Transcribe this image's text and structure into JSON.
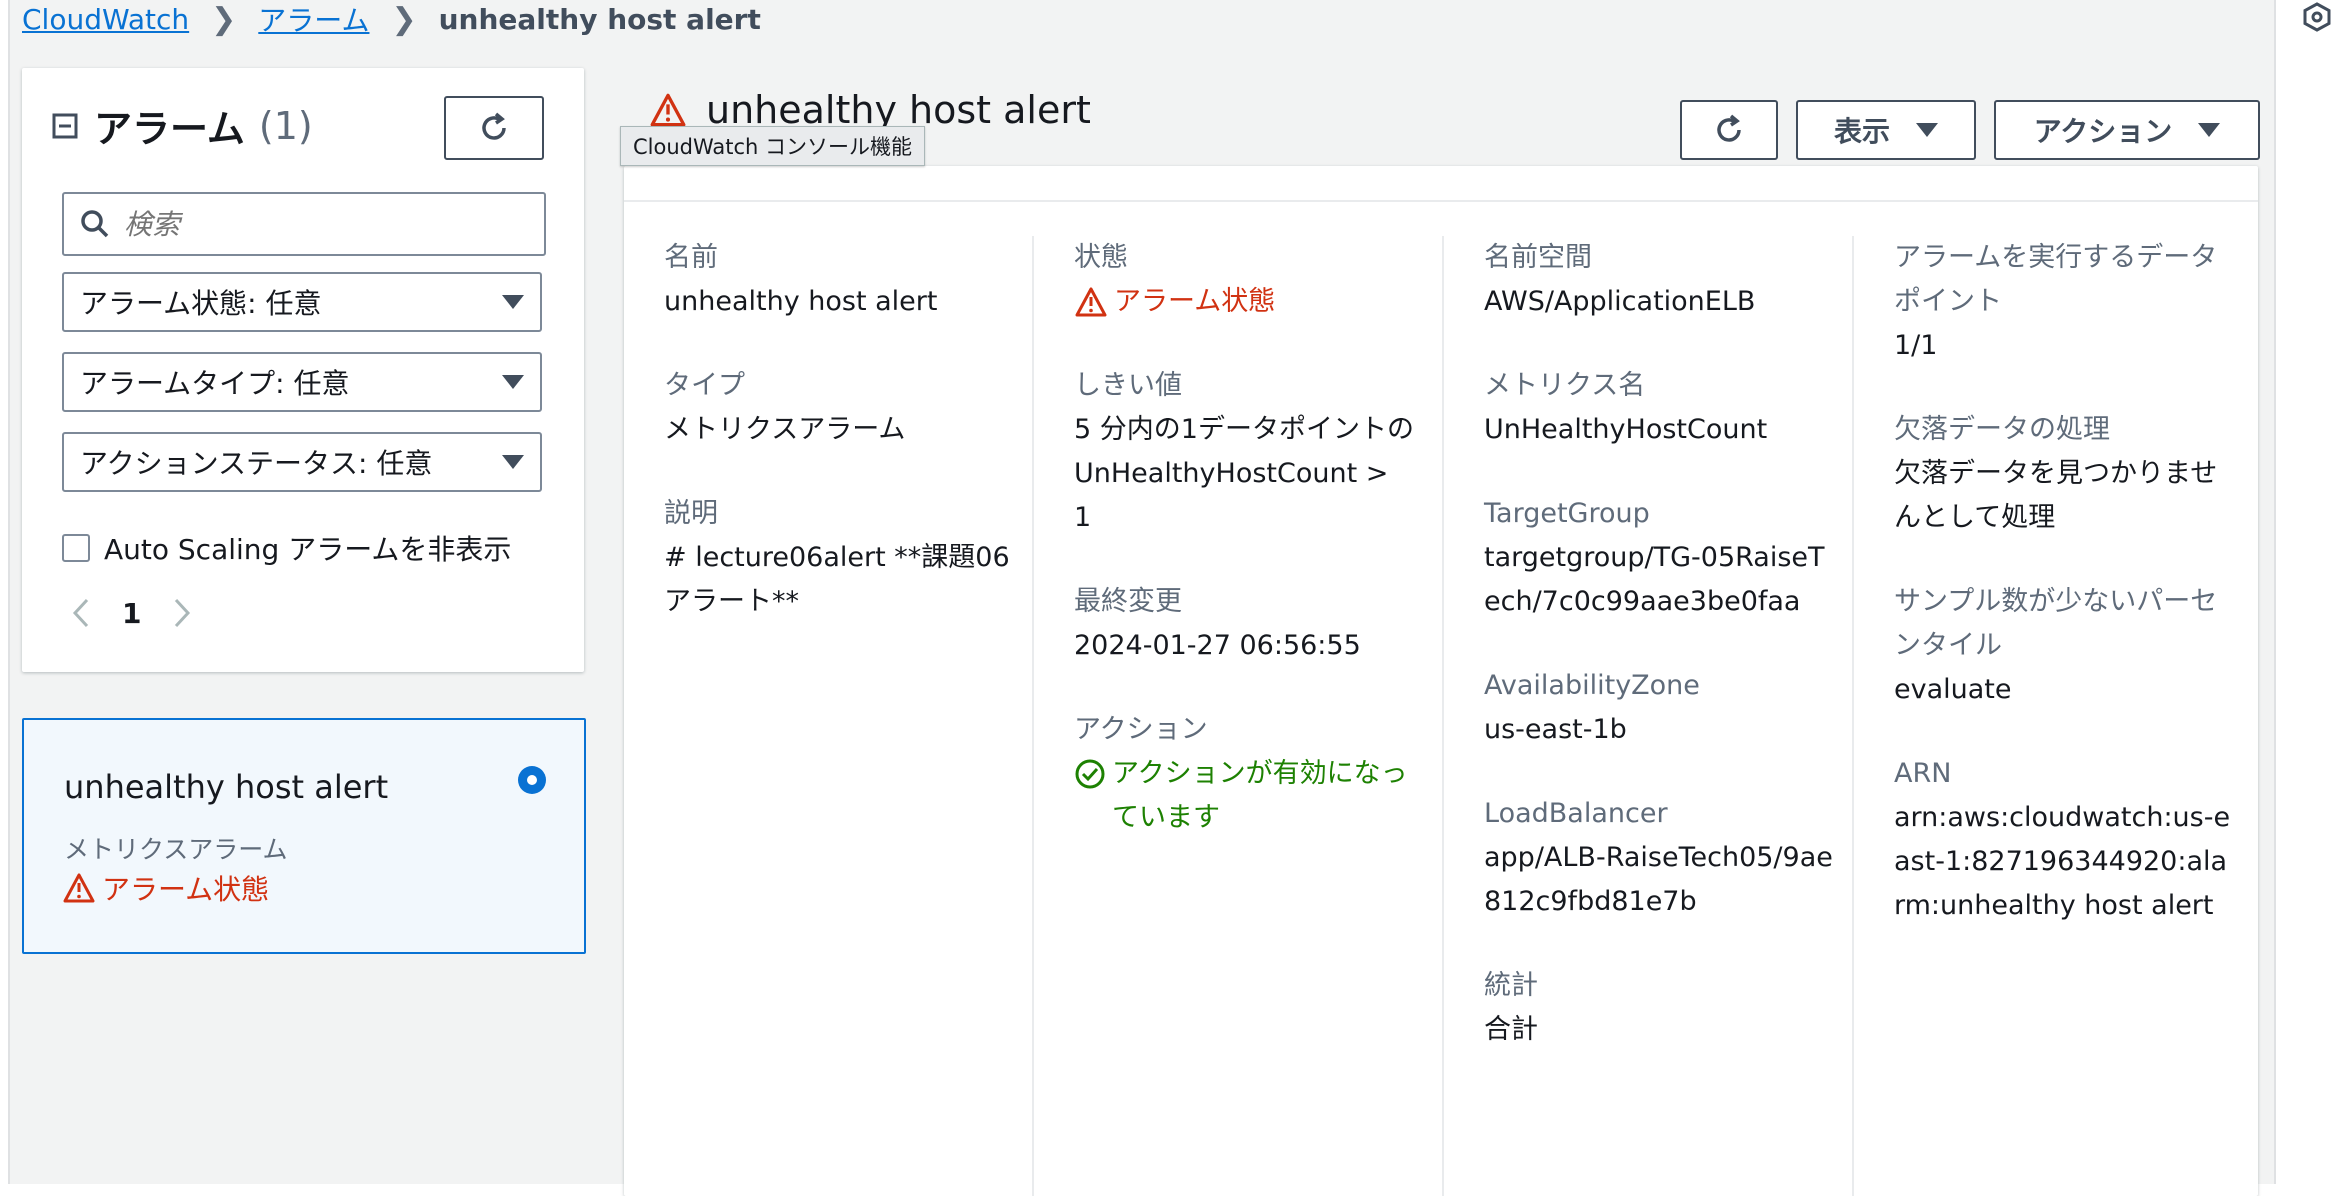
{
  "breadcrumb": {
    "items": [
      "CloudWatch",
      "アラーム"
    ],
    "current": "unhealthy host alert"
  },
  "left_panel": {
    "title": "アラーム",
    "count": "(1)",
    "search_placeholder": "検索",
    "filters": [
      "アラーム状態: 任意",
      "アラームタイプ: 任意",
      "アクションステータス: 任意"
    ],
    "hide_autoscaling_label": "Auto Scaling アラームを非表示",
    "page_number": "1"
  },
  "alarm_card": {
    "name": "unhealthy host alert",
    "type": "メトリクスアラーム",
    "state": "アラーム状態"
  },
  "detail": {
    "title": "unhealthy host alert",
    "tooltip": "CloudWatch コンソール機能",
    "view_button": "表示",
    "actions_button": "アクション",
    "col1": {
      "name_label": "名前",
      "name_value": "unhealthy host alert",
      "type_label": "タイプ",
      "type_value": "メトリクスアラーム",
      "description_label": "説明",
      "description_value": "# lecture06alert **課題06 アラート**"
    },
    "col2": {
      "state_label": "状態",
      "state_value": "アラーム状態",
      "threshold_label": "しきい値",
      "threshold_value": "5 分内の1データポイントのUnHealthyHostCount > 1",
      "last_changed_label": "最終変更",
      "last_changed_value": "2024-01-27 06:56:55",
      "actions_label": "アクション",
      "actions_value": "アクションが有効になっています"
    },
    "col3": {
      "namespace_label": "名前空間",
      "namespace_value": "AWS/ApplicationELB",
      "metric_label": "メトリクス名",
      "metric_value": "UnHealthyHostCount",
      "targetgroup_label": "TargetGroup",
      "targetgroup_value": "targetgroup/TG-05RaiseTech/7c0c99aae3be0faa",
      "az_label": "AvailabilityZone",
      "az_value": "us-east-1b",
      "lb_label": "LoadBalancer",
      "lb_value": "app/ALB-RaiseTech05/9ae812c9fbd81e7b",
      "stat_label": "統計",
      "stat_value": "合計"
    },
    "col4": {
      "datapoints_label": "アラームを実行するデータポイント",
      "datapoints_value": "1/1",
      "missing_label": "欠落データの処理",
      "missing_value": "欠落データを見つかりませんとして処理",
      "percentile_label": "サンプル数が少ないパーセンタイル",
      "percentile_value": "evaluate",
      "arn_label": "ARN",
      "arn_value": "arn:aws:cloudwatch:us-east-1:827196344920:alarm:unhealthy host alert"
    }
  },
  "colors": {
    "link": "#0972d3",
    "alarm": "#d13212",
    "ok": "#1d8102",
    "selected_bg": "#f2f8fd"
  }
}
